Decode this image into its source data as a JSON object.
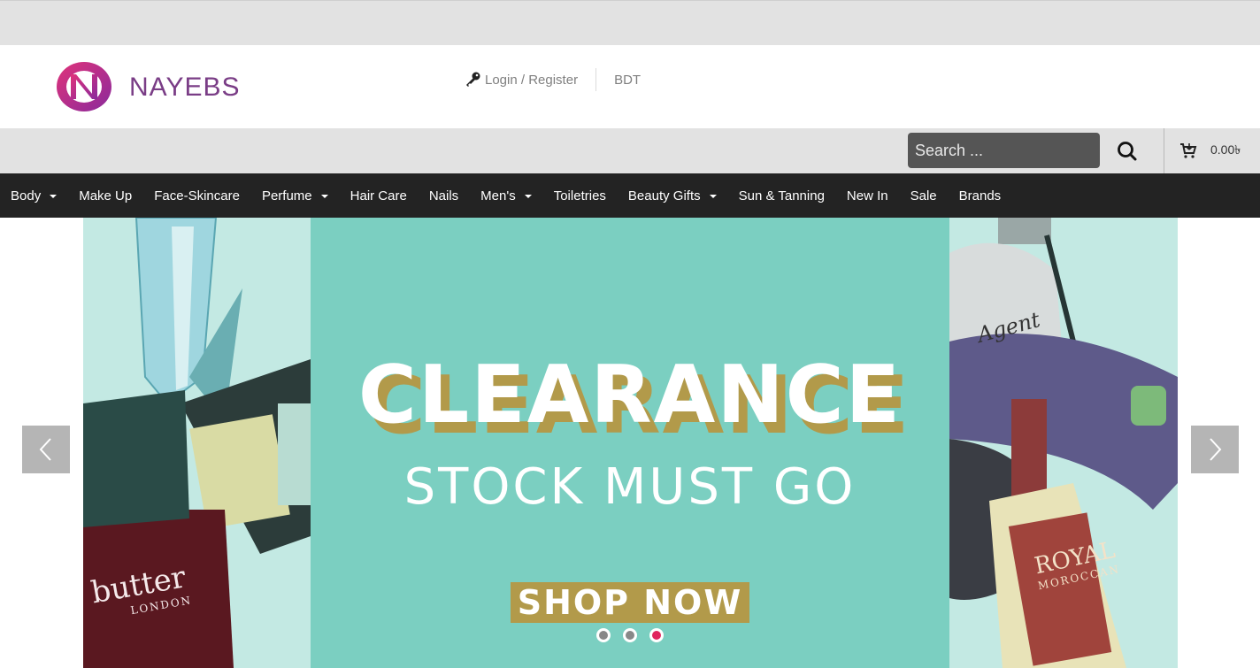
{
  "brand": {
    "name": "NAYEBS",
    "accent": "#b4318c"
  },
  "header": {
    "login_label": "Login / Register",
    "currency": "BDT"
  },
  "search": {
    "placeholder": "Search ..."
  },
  "cart": {
    "total": "0.00৳"
  },
  "nav": {
    "items": [
      {
        "label": "Body",
        "dropdown": true
      },
      {
        "label": "Make Up",
        "dropdown": false
      },
      {
        "label": "Face-Skincare",
        "dropdown": false
      },
      {
        "label": "Perfume",
        "dropdown": true
      },
      {
        "label": "Hair Care",
        "dropdown": false
      },
      {
        "label": "Nails",
        "dropdown": false
      },
      {
        "label": "Men's",
        "dropdown": true
      },
      {
        "label": "Toiletries",
        "dropdown": false
      },
      {
        "label": "Beauty Gifts",
        "dropdown": true
      },
      {
        "label": "Sun & Tanning",
        "dropdown": false
      },
      {
        "label": "New In",
        "dropdown": false
      },
      {
        "label": "Sale",
        "dropdown": false
      },
      {
        "label": "Brands",
        "dropdown": false
      }
    ]
  },
  "slider": {
    "headline": "CLEARANCE",
    "subheadline": "STOCK MUST GO",
    "cta": "SHOP NOW",
    "product_labels": {
      "nail_polish": "butter",
      "nail_polish_sub": "LONDON",
      "bottle": "ROYAL",
      "bottle_sub": "MOROCCAN",
      "agent": "Agent"
    },
    "dots": 3,
    "active_dot": 3,
    "colors": {
      "teal": "#7bcfc1",
      "gold": "#b29a4a",
      "active_dot": "#e0245e"
    }
  }
}
